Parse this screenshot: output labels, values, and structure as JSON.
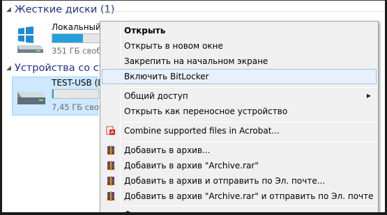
{
  "sections": {
    "hard_drives": {
      "label": "Жесткие диски (1)",
      "chevron": "chevron-down"
    },
    "removable": {
      "label": "Устройства со съ",
      "chevron": "chevron-down"
    }
  },
  "drives": {
    "local": {
      "name": "Локальный д",
      "free": "351 ГБ свобо",
      "used_fraction": 0.65,
      "icon": "windows-drive-icon"
    },
    "usb": {
      "name": "TEST-USB (D",
      "free": "7,45 ГБ своб",
      "used_fraction": 0.03,
      "icon": "usb-drive-icon",
      "selected": true
    }
  },
  "menu": {
    "open": "Открыть",
    "open_new_window": "Открыть в новом окне",
    "pin_start": "Закрепить на начальном экране",
    "bitlocker": "Включить BitLocker",
    "sharing": "Общий доступ",
    "open_portable": "Открыть как переносное устройство",
    "acrobat": "Combine supported files in Acrobat...",
    "add_archive": "Добавить в архив...",
    "add_archive_rar": "Добавить в архив \"Archive.rar\"",
    "add_archive_email": "Добавить в архив и отправить по Эл. почте...",
    "add_archive_rar_email": "Добавить в архив \"Archive.rar\" и отправить по Эл. почте",
    "format": "Форматировать..."
  },
  "colors": {
    "section_header": "#1e3287",
    "selection_bg": "#cde8ff",
    "menu_highlight": "#e8f1fb",
    "bar_fill": "#26a0da"
  }
}
